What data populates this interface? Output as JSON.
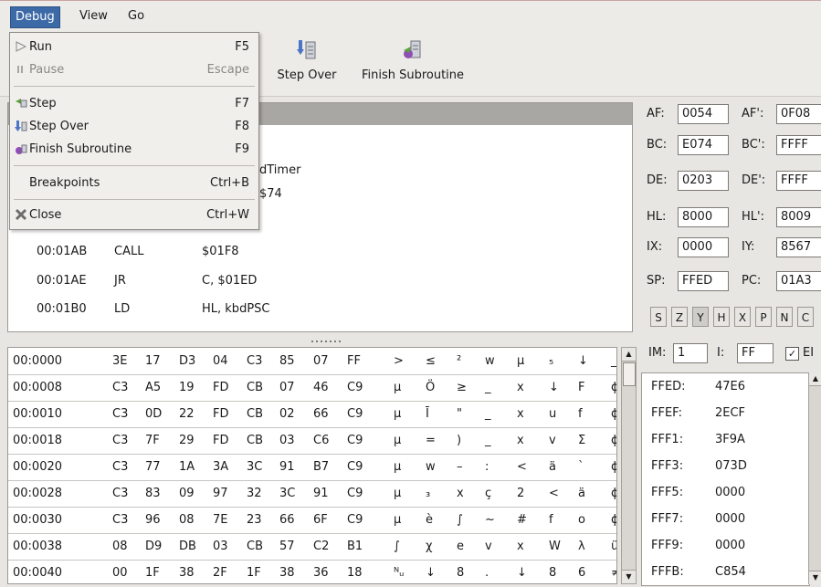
{
  "menubar": {
    "items": [
      {
        "label": "Debug",
        "active": true
      },
      {
        "label": "View",
        "active": false
      },
      {
        "label": "Go",
        "active": false
      }
    ]
  },
  "toolbar": {
    "step_over_label": "Step Over",
    "finish_label": "Finish Subroutine"
  },
  "debug_menu": {
    "run": {
      "label": "Run",
      "accel": "F5"
    },
    "pause": {
      "label": "Pause",
      "accel": "Escape"
    },
    "step": {
      "label": "Step",
      "accel": "F7"
    },
    "step_over": {
      "label": "Step Over",
      "accel": "F8"
    },
    "finish": {
      "label": "Finish Subroutine",
      "accel": "F9"
    },
    "breakpoints": {
      "label": "Breakpoints",
      "accel": "Ctrl+B"
    },
    "close": {
      "label": "Close",
      "accel": "Ctrl+W"
    }
  },
  "disassembly": {
    "partial": [
      "dTimer",
      "$74"
    ],
    "rows": [
      {
        "addr": "00:01AB",
        "op": "CALL",
        "args": "$01F8"
      },
      {
        "addr": "00:01AE",
        "op": "JR",
        "args": "C, $01ED"
      },
      {
        "addr": "00:01B0",
        "op": "LD",
        "args": "HL, kbdPSC"
      }
    ]
  },
  "memory": {
    "rows": [
      {
        "addr": "00:0000",
        "bytes": [
          "3E",
          "17",
          "D3",
          "04",
          "C3",
          "85",
          "07",
          "FF"
        ],
        "chars": [
          ">",
          "≤",
          "²",
          "w",
          "μ",
          "₅",
          "↓",
          "_"
        ]
      },
      {
        "addr": "00:0008",
        "bytes": [
          "C3",
          "A5",
          "19",
          "FD",
          "CB",
          "07",
          "46",
          "C9"
        ],
        "chars": [
          "μ",
          "Ö",
          "≥",
          "_",
          "x",
          "↓",
          "F",
          "ϕ"
        ]
      },
      {
        "addr": "00:0010",
        "bytes": [
          "C3",
          "0D",
          "22",
          "FD",
          "CB",
          "02",
          "66",
          "C9"
        ],
        "chars": [
          "μ",
          "Ī",
          "\"",
          "_",
          "x",
          "u",
          "f",
          "ϕ"
        ]
      },
      {
        "addr": "00:0018",
        "bytes": [
          "C3",
          "7F",
          "29",
          "FD",
          "CB",
          "03",
          "C6",
          "C9"
        ],
        "chars": [
          "μ",
          "=",
          ")",
          "_",
          "x",
          "v",
          "Σ",
          "ϕ"
        ]
      },
      {
        "addr": "00:0020",
        "bytes": [
          "C3",
          "77",
          "1A",
          "3A",
          "3C",
          "91",
          "B7",
          "C9"
        ],
        "chars": [
          "μ",
          "w",
          "–",
          ":",
          "<",
          "ä",
          "`",
          "ϕ"
        ]
      },
      {
        "addr": "00:0028",
        "bytes": [
          "C3",
          "83",
          "09",
          "97",
          "32",
          "3C",
          "91",
          "C9"
        ],
        "chars": [
          "μ",
          "₃",
          "x",
          "ç",
          "2",
          "<",
          "ä",
          "ϕ"
        ]
      },
      {
        "addr": "00:0030",
        "bytes": [
          "C3",
          "96",
          "08",
          "7E",
          "23",
          "66",
          "6F",
          "C9"
        ],
        "chars": [
          "μ",
          "è",
          "∫",
          "~",
          "#",
          "f",
          "o",
          "ϕ"
        ]
      },
      {
        "addr": "00:0038",
        "bytes": [
          "08",
          "D9",
          "DB",
          "03",
          "CB",
          "57",
          "C2",
          "B1"
        ],
        "chars": [
          "∫",
          "χ",
          "e",
          "v",
          "x",
          "W",
          "λ",
          "ü"
        ]
      },
      {
        "addr": "00:0040",
        "bytes": [
          "00",
          "1F",
          "38",
          "2F",
          "1F",
          "38",
          "36",
          "18"
        ],
        "chars": [
          "ᴺᵤ",
          "↓",
          "8",
          ".",
          "↓",
          "8",
          "6",
          "≠"
        ]
      }
    ]
  },
  "registers": [
    {
      "label": "AF:",
      "value": "0054"
    },
    {
      "label": "AF':",
      "value": "0F08"
    },
    {
      "label": "BC:",
      "value": "E074"
    },
    {
      "label": "BC':",
      "value": "FFFF"
    },
    {
      "label": "DE:",
      "value": "0203"
    },
    {
      "label": "DE':",
      "value": "FFFF"
    },
    {
      "label": "HL:",
      "value": "8000"
    },
    {
      "label": "HL':",
      "value": "8009"
    },
    {
      "label": "IX:",
      "value": "0000"
    },
    {
      "label": "IY:",
      "value": "8567"
    },
    {
      "label": "SP:",
      "value": "FFED"
    },
    {
      "label": "PC:",
      "value": "01A3"
    }
  ],
  "flags": [
    {
      "label": "S",
      "on": false
    },
    {
      "label": "Z",
      "on": false
    },
    {
      "label": "Y",
      "on": true
    },
    {
      "label": "H",
      "on": false
    },
    {
      "label": "X",
      "on": false
    },
    {
      "label": "P",
      "on": false
    },
    {
      "label": "N",
      "on": false
    },
    {
      "label": "C",
      "on": false
    }
  ],
  "interrupts": {
    "im_label": "IM:",
    "im_value": "1",
    "i_label": "I:",
    "i_value": "FF",
    "ei_label": "EI",
    "ei_checked": true
  },
  "stack": {
    "rows": [
      {
        "addr": "FFED:",
        "value": "47E6"
      },
      {
        "addr": "FFEF:",
        "value": "2ECF"
      },
      {
        "addr": "FFF1:",
        "value": "3F9A"
      },
      {
        "addr": "FFF3:",
        "value": "073D"
      },
      {
        "addr": "FFF5:",
        "value": "0000"
      },
      {
        "addr": "FFF7:",
        "value": "0000"
      },
      {
        "addr": "FFF9:",
        "value": "0000"
      },
      {
        "addr": "FFFB:",
        "value": "C854"
      }
    ]
  }
}
